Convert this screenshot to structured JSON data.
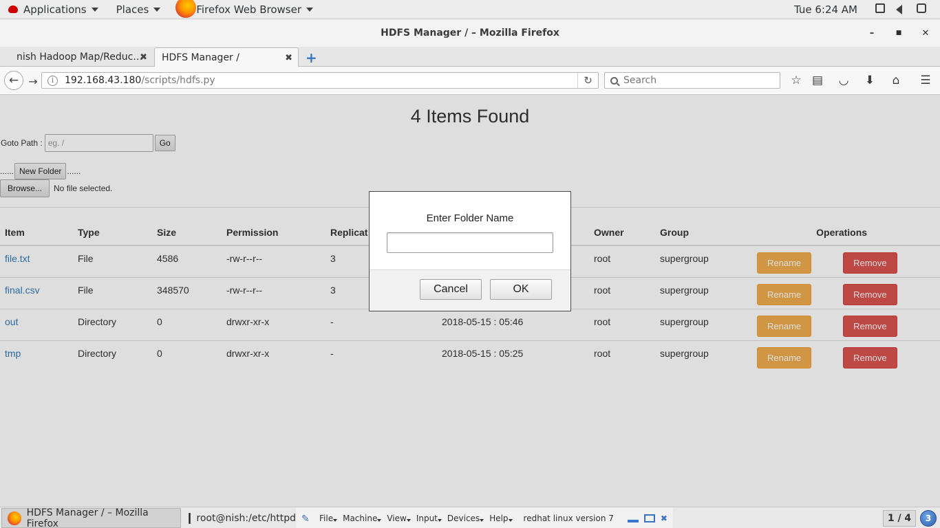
{
  "topbar": {
    "applications": "Applications",
    "places": "Places",
    "app_name": "Firefox Web Browser",
    "clock": "Tue  6:24 AM"
  },
  "window": {
    "title": "HDFS Manager / – Mozilla Firefox",
    "minimize": "–",
    "maximize": "■",
    "close": "✕"
  },
  "tabs": [
    {
      "label": "nish Hadoop Map/Reduc…",
      "close": "✖"
    },
    {
      "label": "HDFS Manager /",
      "close": "✖"
    }
  ],
  "new_tab": "+",
  "navbar": {
    "back": "←",
    "forward": "→",
    "info": "i",
    "url_host": "192.168.43.180",
    "url_path": "/scripts/hdfs.py",
    "reload": "↻",
    "search_placeholder": "Search"
  },
  "page": {
    "heading": "4 Items Found",
    "goto_label": "Goto Path :",
    "goto_placeholder": "eg. /",
    "go_button": "Go",
    "dots_left": "......",
    "new_folder": "New Folder",
    "dots_right": "......",
    "browse": "Browse...",
    "no_file": "No file selected."
  },
  "table": {
    "headers": [
      "Item",
      "Type",
      "Size",
      "Permission",
      "Replicat",
      "",
      "Owner",
      "Group",
      "",
      "Operations"
    ],
    "rows": [
      {
        "name": "file.txt",
        "type": "File",
        "size": "4586",
        "permission": "-rw-r--r--",
        "replication": "3",
        "modified": "",
        "owner": "root",
        "group": "supergroup"
      },
      {
        "name": "final.csv",
        "type": "File",
        "size": "348570",
        "permission": "-rw-r--r--",
        "replication": "3",
        "modified": "",
        "owner": "root",
        "group": "supergroup"
      },
      {
        "name": "out",
        "type": "Directory",
        "size": "0",
        "permission": "drwxr-xr-x",
        "replication": "-",
        "modified": "2018-05-15 : 05:46",
        "owner": "root",
        "group": "supergroup"
      },
      {
        "name": "tmp",
        "type": "Directory",
        "size": "0",
        "permission": "drwxr-xr-x",
        "replication": "-",
        "modified": "2018-05-15 : 05:25",
        "owner": "root",
        "group": "supergroup"
      }
    ],
    "rename_label": "Rename",
    "remove_label": "Remove"
  },
  "dialog": {
    "title": "Enter Folder Name",
    "input_value": "",
    "cancel": "Cancel",
    "ok": "OK"
  },
  "taskbar": {
    "firefox_task": "HDFS Manager / – Mozilla Firefox",
    "terminal_task": "root@nish:/etc/httpd",
    "vbox_menu": [
      "File",
      "Machine",
      "View",
      "Input",
      "Devices",
      "Help"
    ],
    "vbox_status": "redhat linux version 7",
    "workspace": "1 / 4",
    "workspace_badge": "3"
  },
  "colors": {
    "rename": "#f0ad4e",
    "remove": "#d9534f",
    "link": "#337ab7"
  }
}
